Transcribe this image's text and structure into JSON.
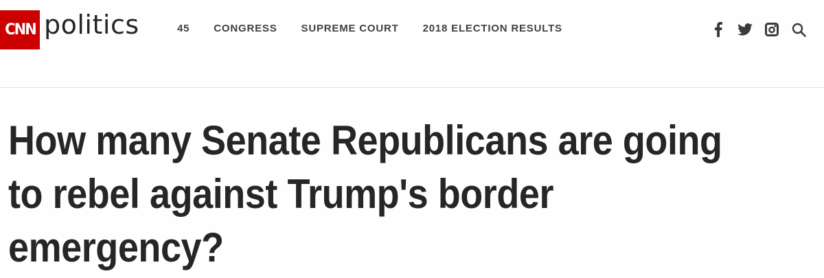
{
  "brand": {
    "logo_text": "CNN",
    "section": "politics",
    "accent_color": "#cc0000"
  },
  "nav": {
    "items": [
      {
        "label": "45"
      },
      {
        "label": "CONGRESS"
      },
      {
        "label": "SUPREME COURT"
      },
      {
        "label": "2018 ELECTION RESULTS"
      }
    ]
  },
  "icons": [
    "facebook-icon",
    "twitter-icon",
    "instagram-icon",
    "search-icon"
  ],
  "article": {
    "headline": "How many Senate Republicans are going to rebel against Trump's border emergency?"
  }
}
